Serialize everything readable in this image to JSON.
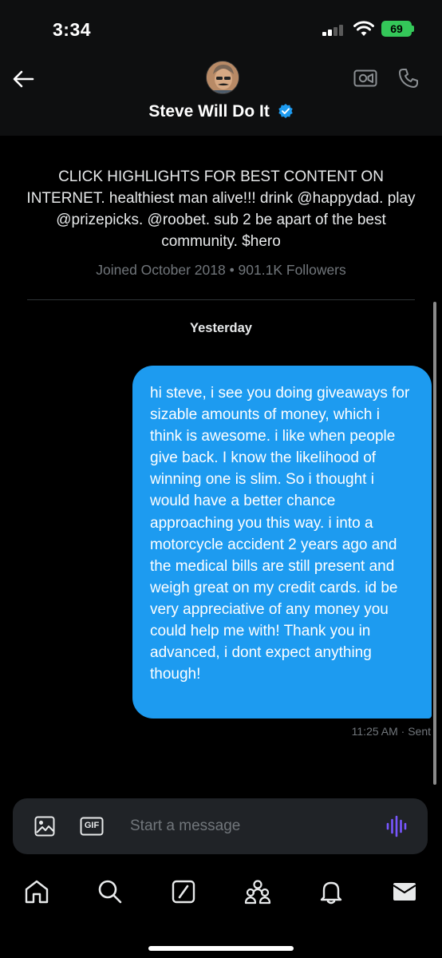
{
  "status_bar": {
    "time": "3:34",
    "battery": "69"
  },
  "header": {
    "name": "Steve Will Do It",
    "verified": true,
    "accent_color": "#1d9bf0"
  },
  "profile": {
    "bio": "CLICK HIGHLIGHTS FOR BEST CONTENT ON INTERNET. healthiest man alive!!! drink @happydad. play @prizepicks. @roobet. sub 2 be apart of the best community. $hero",
    "meta": "Joined October 2018 • 901.1K Followers"
  },
  "conversation": {
    "day_label": "Yesterday",
    "messages": [
      {
        "text": "hi steve, i see you doing giveaways for sizable amounts of money, which i think is awesome. i like when people give back. I know the likelihood of winning one is slim. So i thought i would have a better chance approaching you this way. i into a motorcycle accident 2 years ago and the medical bills are still present and weigh great on my credit cards. id be very appreciative of any money you could help me with! Thank you in advanced, i dont expect anything though!",
        "timestamp": "11:25 AM · Sent",
        "bubble_color": "#1d9bf0"
      }
    ]
  },
  "composer": {
    "placeholder": "Start a message",
    "gif_label": "GIF"
  },
  "icons": {
    "back": "back-arrow-icon",
    "video": "video-call-icon",
    "phone": "phone-call-icon",
    "media": "image-icon",
    "gif": "gif-icon",
    "voice": "voice-wave-icon",
    "nav": [
      "home-icon",
      "search-icon",
      "grok-icon",
      "communities-icon",
      "notifications-icon",
      "messages-icon"
    ]
  }
}
